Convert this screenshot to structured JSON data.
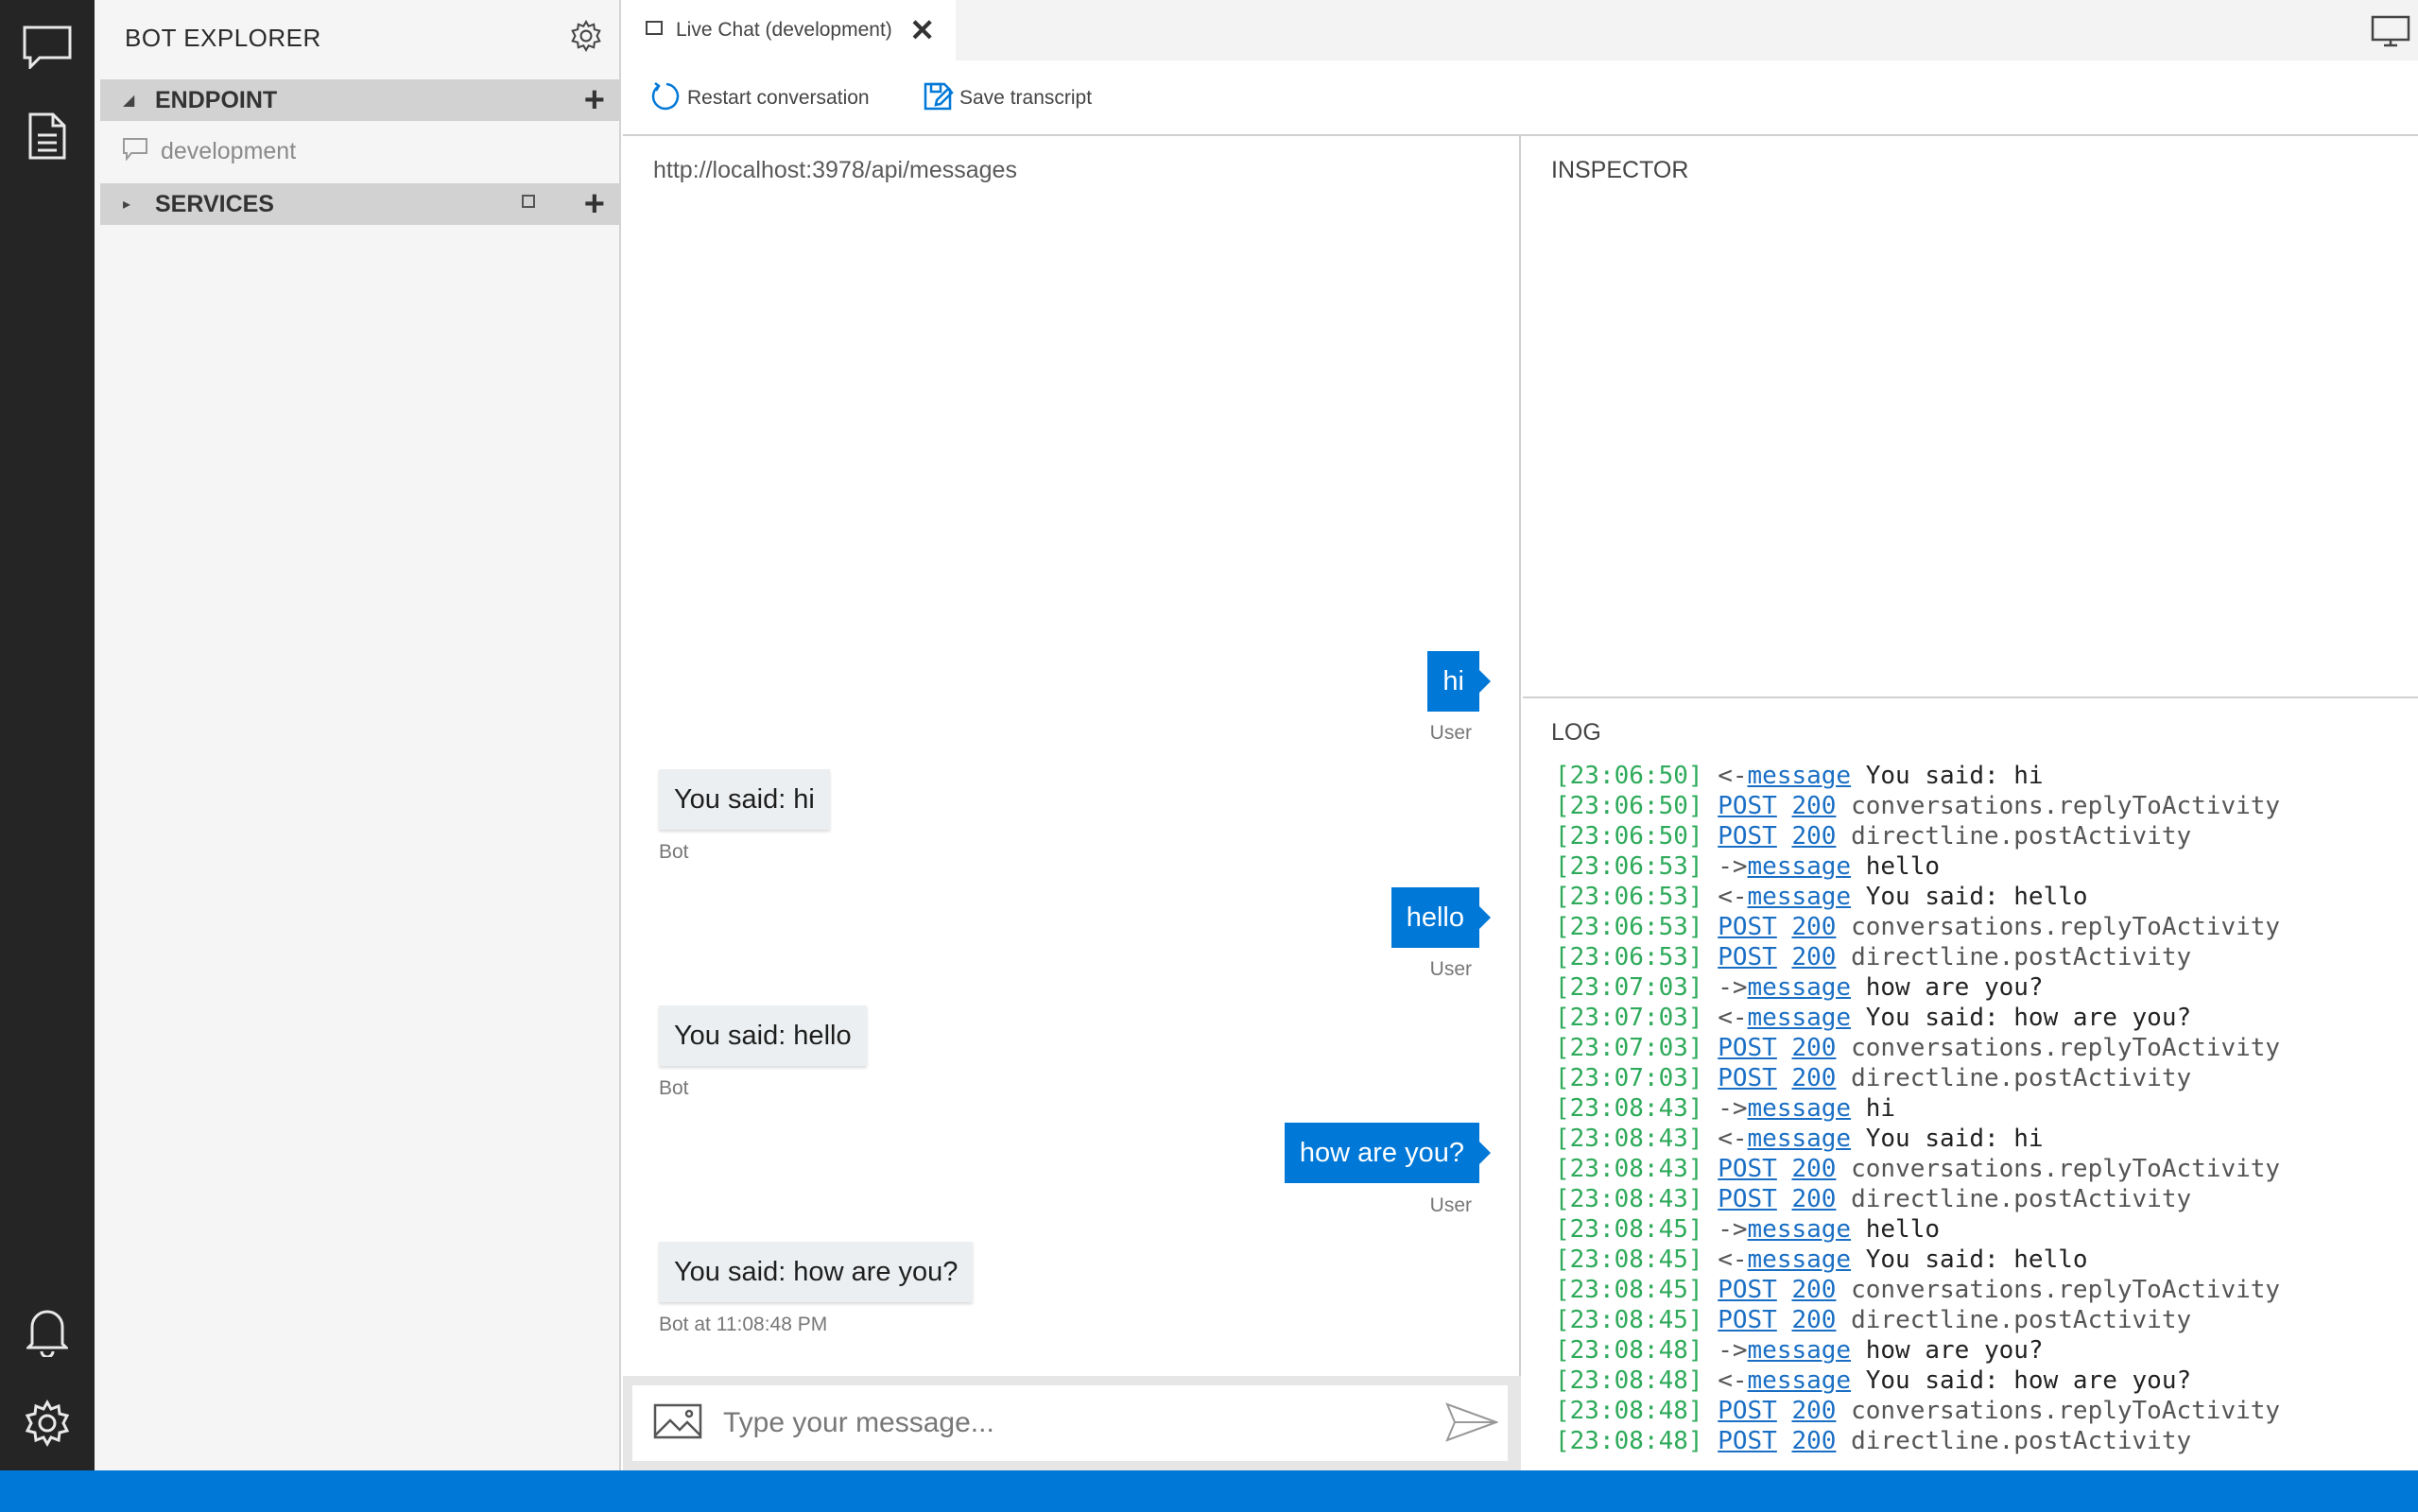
{
  "activity": {
    "items": [
      "chat-icon",
      "document-icon",
      "bell-icon",
      "gear-icon"
    ]
  },
  "explorer": {
    "title": "BOT EXPLORER",
    "endpoint": {
      "label": "ENDPOINT",
      "item": "development"
    },
    "services": {
      "label": "SERVICES"
    }
  },
  "tabs": [
    {
      "label": "Live Chat (development)"
    }
  ],
  "toolbar": {
    "restart_label": "Restart conversation",
    "save_label": "Save transcript"
  },
  "chat": {
    "url": "http://localhost:3978/api/messages",
    "messages": [
      {
        "from": "user",
        "text": "hi",
        "meta": "User"
      },
      {
        "from": "bot",
        "text": "You said: hi",
        "meta": "Bot"
      },
      {
        "from": "user",
        "text": "hello",
        "meta": "User"
      },
      {
        "from": "bot",
        "text": "You said: hello",
        "meta": "Bot"
      },
      {
        "from": "user",
        "text": "how are you?",
        "meta": "User"
      },
      {
        "from": "bot",
        "text": "You said: how are you?",
        "meta": "Bot at 11:08:48 PM"
      }
    ],
    "input_placeholder": "Type your message..."
  },
  "inspector": {
    "title": "INSPECTOR"
  },
  "log": {
    "title": "LOG",
    "lines": [
      {
        "time": "[23:06:50]",
        "dir": "<-",
        "kind": "message",
        "code": "",
        "text": "You said: hi"
      },
      {
        "time": "[23:06:50]",
        "dir": "",
        "kind": "POST",
        "code": "200",
        "text": "conversations.replyToActivity"
      },
      {
        "time": "[23:06:50]",
        "dir": "",
        "kind": "POST",
        "code": "200",
        "text": "directline.postActivity"
      },
      {
        "time": "[23:06:53]",
        "dir": "->",
        "kind": "message",
        "code": "",
        "text": "hello"
      },
      {
        "time": "[23:06:53]",
        "dir": "<-",
        "kind": "message",
        "code": "",
        "text": "You said: hello"
      },
      {
        "time": "[23:06:53]",
        "dir": "",
        "kind": "POST",
        "code": "200",
        "text": "conversations.replyToActivity"
      },
      {
        "time": "[23:06:53]",
        "dir": "",
        "kind": "POST",
        "code": "200",
        "text": "directline.postActivity"
      },
      {
        "time": "[23:07:03]",
        "dir": "->",
        "kind": "message",
        "code": "",
        "text": "how are you?"
      },
      {
        "time": "[23:07:03]",
        "dir": "<-",
        "kind": "message",
        "code": "",
        "text": "You said: how are you?"
      },
      {
        "time": "[23:07:03]",
        "dir": "",
        "kind": "POST",
        "code": "200",
        "text": "conversations.replyToActivity"
      },
      {
        "time": "[23:07:03]",
        "dir": "",
        "kind": "POST",
        "code": "200",
        "text": "directline.postActivity"
      },
      {
        "time": "[23:08:43]",
        "dir": "->",
        "kind": "message",
        "code": "",
        "text": "hi"
      },
      {
        "time": "[23:08:43]",
        "dir": "<-",
        "kind": "message",
        "code": "",
        "text": "You said: hi"
      },
      {
        "time": "[23:08:43]",
        "dir": "",
        "kind": "POST",
        "code": "200",
        "text": "conversations.replyToActivity"
      },
      {
        "time": "[23:08:43]",
        "dir": "",
        "kind": "POST",
        "code": "200",
        "text": "directline.postActivity"
      },
      {
        "time": "[23:08:45]",
        "dir": "->",
        "kind": "message",
        "code": "",
        "text": "hello"
      },
      {
        "time": "[23:08:45]",
        "dir": "<-",
        "kind": "message",
        "code": "",
        "text": "You said: hello"
      },
      {
        "time": "[23:08:45]",
        "dir": "",
        "kind": "POST",
        "code": "200",
        "text": "conversations.replyToActivity"
      },
      {
        "time": "[23:08:45]",
        "dir": "",
        "kind": "POST",
        "code": "200",
        "text": "directline.postActivity"
      },
      {
        "time": "[23:08:48]",
        "dir": "->",
        "kind": "message",
        "code": "",
        "text": "how are you?"
      },
      {
        "time": "[23:08:48]",
        "dir": "<-",
        "kind": "message",
        "code": "",
        "text": "You said: how are you?"
      },
      {
        "time": "[23:08:48]",
        "dir": "",
        "kind": "POST",
        "code": "200",
        "text": "conversations.replyToActivity"
      },
      {
        "time": "[23:08:48]",
        "dir": "",
        "kind": "POST",
        "code": "200",
        "text": "directline.postActivity"
      }
    ]
  },
  "colors": {
    "accent": "#0078d7",
    "activity_bg": "#252526",
    "timestamp": "#2eaa5a",
    "link": "#1a6fc4"
  }
}
